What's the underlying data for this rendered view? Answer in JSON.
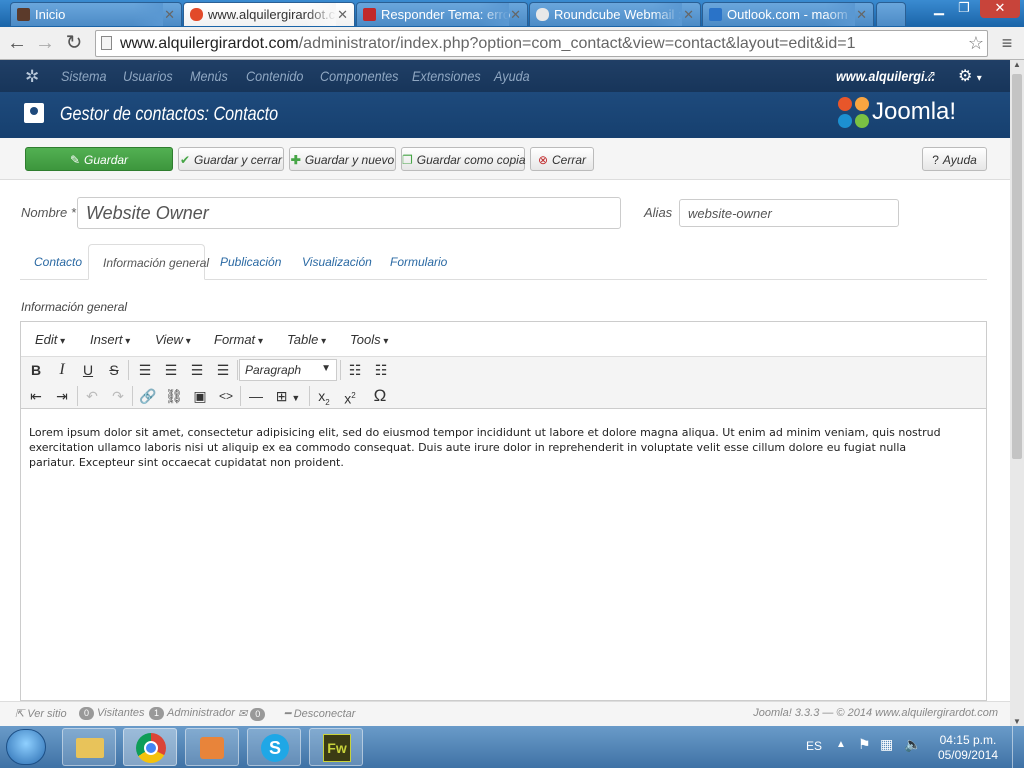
{
  "browser": {
    "tabs": [
      {
        "label": "Inicio"
      },
      {
        "label": "www.alquilergirardot.c"
      },
      {
        "label": "Responder Tema: erro"
      },
      {
        "label": "Roundcube Webmail :"
      },
      {
        "label": "Outlook.com - maom"
      }
    ],
    "url_domain": "www.alquilergirardot.com",
    "url_path": "/administrator/index.php?option=com_contact&view=contact&layout=edit&id=1"
  },
  "joomla": {
    "menu": [
      "Sistema",
      "Usuarios",
      "Menús",
      "Contenido",
      "Componentes",
      "Extensiones",
      "Ayuda"
    ],
    "site_link": "www.alquilergi...",
    "page_title": "Gestor de contactos: Contacto",
    "brand": "Joomla!",
    "toolbar": {
      "save": "Guardar",
      "save_close": "Guardar y cerrar",
      "save_new": "Guardar y nuevo",
      "save_copy": "Guardar como copia",
      "close": "Cerrar",
      "help": "Ayuda"
    },
    "form": {
      "name_label": "Nombre *",
      "name_value": "Website Owner",
      "alias_label": "Alias",
      "alias_value": "website-owner"
    },
    "tabs": [
      "Contacto",
      "Información general",
      "Publicación",
      "Visualización",
      "Formulario"
    ],
    "section_label": "Información general",
    "editor": {
      "menu": [
        "Edit",
        "Insert",
        "View",
        "Format",
        "Table",
        "Tools"
      ],
      "format_select": "Paragraph",
      "content": "Lorem ipsum dolor sit amet, consectetur adipisicing elit, sed do eiusmod tempor incididunt ut labore et dolore magna aliqua. Ut enim ad minim veniam, quis nostrud exercitation ullamco laboris nisi ut aliquip ex ea commodo consequat. Duis aute irure dolor in reprehenderit in voluptate velit esse cillum dolore eu fugiat nulla pariatur. Excepteur sint occaecat cupidatat non proident."
    },
    "status": {
      "view_site": "Ver sitio",
      "visitors_count": "0",
      "visitors": "Visitantes",
      "admin_count": "1",
      "admin": "Administrador",
      "messages_count": "0",
      "logout": "Desconectar",
      "version": "Joomla! 3.3.3 — © 2014 www.alquilergirardot.com"
    }
  },
  "taskbar": {
    "lang": "ES",
    "time": "04:15 p.m.",
    "date": "05/09/2014"
  },
  "colors": {
    "accent": "#1b3a5f",
    "save": "#46a546",
    "link": "#2a69a3"
  }
}
